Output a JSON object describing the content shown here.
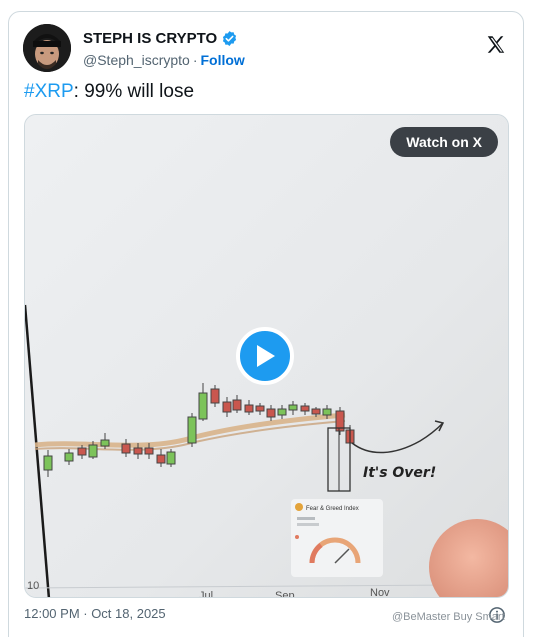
{
  "author": {
    "display_name": "STEPH IS CRYPTO",
    "handle": "@Steph_iscrypto",
    "separator": "·",
    "follow_label": "Follow"
  },
  "tweet": {
    "hashtag": "#XRP",
    "text": ": 99% will lose",
    "timestamp": "12:00 PM · Oct 18, 2025"
  },
  "media": {
    "watch_label": "Watch on X",
    "chart_annotation": "It's Over!",
    "axis_labels": [
      "Jul",
      "Sep",
      "Nov"
    ],
    "left_axis_label": "10",
    "widget_title": "Fear & Greed Index"
  },
  "watermark": "@BeMaster Buy Smart",
  "colors": {
    "accent": "#1d9bf0",
    "follow": "#006fd6",
    "verified": "#1d9bf0",
    "candle_up": "#7cc35a",
    "candle_down": "#c9574e"
  },
  "icons": {
    "verified": "verified-badge-icon",
    "x_logo": "x-logo-icon",
    "play": "play-icon",
    "info": "info-icon"
  }
}
